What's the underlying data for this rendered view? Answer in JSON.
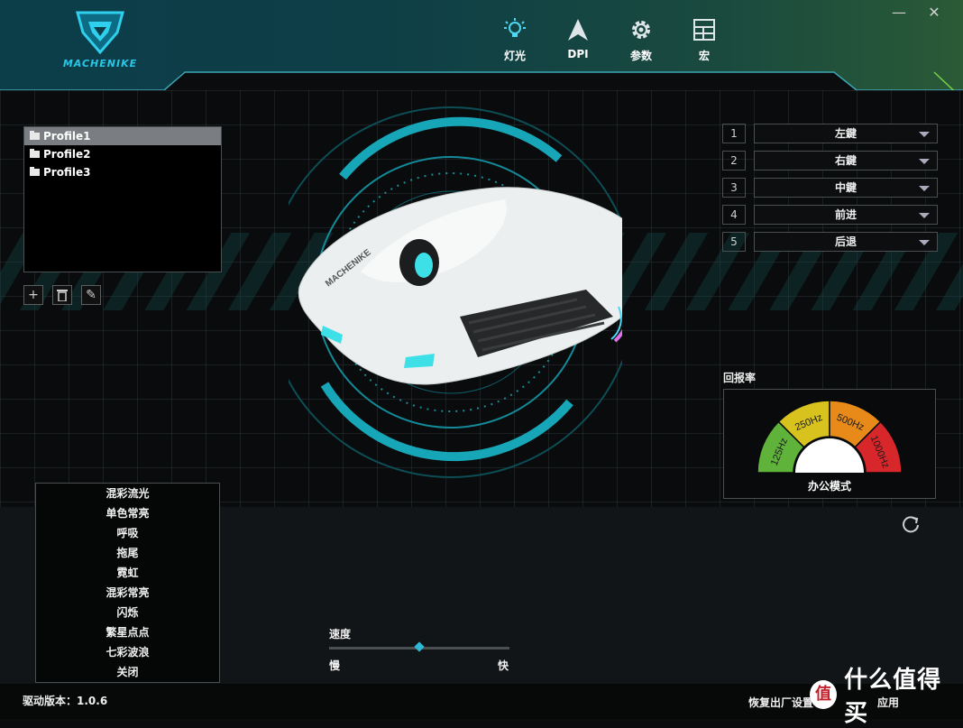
{
  "header": {
    "brand": "MACHENIKE",
    "nav": [
      {
        "label": "灯光",
        "icon": "lightbulb-icon"
      },
      {
        "label": "DPI",
        "icon": "dpi-arrow-icon"
      },
      {
        "label": "参数",
        "icon": "gear-icon"
      },
      {
        "label": "宏",
        "icon": "macro-grid-icon"
      }
    ],
    "window_controls": {
      "minimize": "—",
      "close": "✕"
    }
  },
  "profiles": {
    "items": [
      "Profile1",
      "Profile2",
      "Profile3"
    ],
    "selected": "Profile1",
    "tools": [
      {
        "icon": "add-icon",
        "glyph": "+"
      },
      {
        "icon": "delete-icon",
        "glyph": "🗑"
      },
      {
        "icon": "edit-icon",
        "glyph": "✎"
      }
    ]
  },
  "mouse_image": {
    "brand_text": "MACHENIKE"
  },
  "button_mapping": [
    {
      "number": "1",
      "value": "左鍵"
    },
    {
      "number": "2",
      "value": "右鍵"
    },
    {
      "number": "3",
      "value": "中鍵"
    },
    {
      "number": "4",
      "value": "前进"
    },
    {
      "number": "5",
      "value": "后退"
    }
  ],
  "polling_rate": {
    "title": "回报率",
    "options": [
      "125Hz",
      "250Hz",
      "500Hz",
      "1000Hz"
    ],
    "colors": [
      "#5fb33a",
      "#d8c21e",
      "#e88a1a",
      "#d8272a"
    ],
    "mode": "办公模式"
  },
  "lighting": {
    "effects": [
      "混彩流光",
      "单色常亮",
      "呼吸",
      "拖尾",
      "霓虹",
      "混彩常亮",
      "闪烁",
      "繁星点点",
      "七彩波浪",
      "关闭"
    ],
    "speed": {
      "label": "速度",
      "slow": "慢",
      "fast": "快",
      "value": 0.5
    }
  },
  "footer": {
    "driver_version": "驱动版本：1.0.6",
    "reset": "恢复出厂设置",
    "apply": "应用"
  },
  "watermark": {
    "logo": "值",
    "text": "什么值得买"
  },
  "colors": {
    "accent": "#2fb8d6",
    "header_dark": "#0c3e4a",
    "header_green": "#2a5a36"
  }
}
